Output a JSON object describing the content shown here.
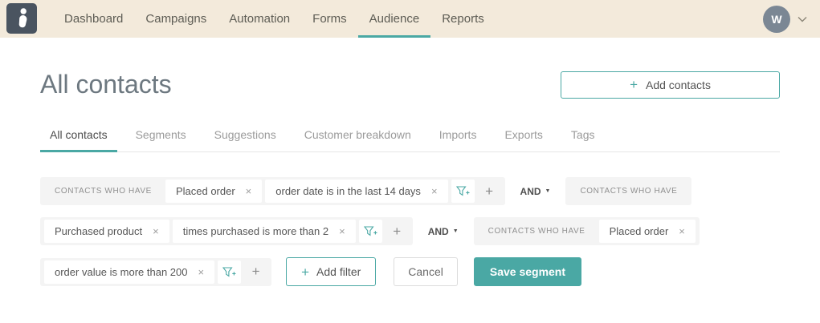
{
  "icons": {
    "plus": "+",
    "close": "×",
    "caret_down": "▼"
  },
  "colors": {
    "accent_teal": "#4aa8a4",
    "header_bg": "#f3eadb",
    "logo_bg": "#4a5460",
    "avatar_bg": "#7b8794"
  },
  "header": {
    "nav": [
      "Dashboard",
      "Campaigns",
      "Automation",
      "Forms",
      "Audience",
      "Reports"
    ],
    "active_nav": "Audience",
    "avatar_initial": "W"
  },
  "page": {
    "title": "All contacts",
    "add_contacts": "Add contacts"
  },
  "tabs": [
    "All contacts",
    "Segments",
    "Suggestions",
    "Customer breakdown",
    "Imports",
    "Exports",
    "Tags"
  ],
  "active_tab": "All contacts",
  "segment_builder": {
    "group_label": "CONTACTS WHO HAVE",
    "and_label": "AND",
    "row1": {
      "chip1": "Placed order",
      "chip2": "order date is in the last 14 days"
    },
    "row2": {
      "chip1": "Purchased product",
      "chip2": "times purchased is more than 2",
      "group2_chip": "Placed order"
    },
    "row3": {
      "chip1": "order value is more than 200"
    },
    "add_filter": "Add filter",
    "cancel": "Cancel",
    "save": "Save segment"
  }
}
